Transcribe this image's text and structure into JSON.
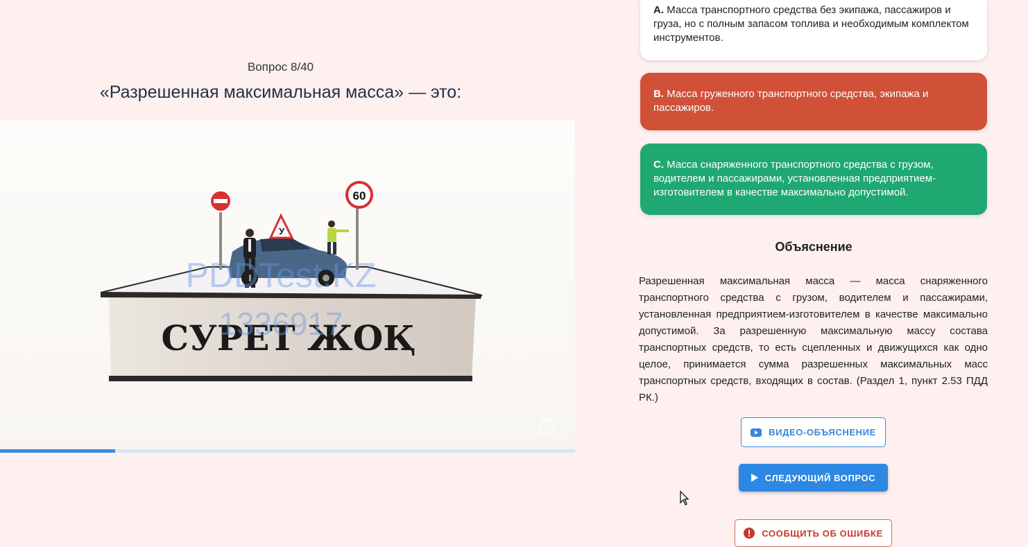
{
  "question": {
    "counter": "Вопрос 8/40",
    "title": "«Разрешенная максимальная масса» — это:",
    "progress_fraction": 0.2
  },
  "image": {
    "placeholder_text": "СУРЕТ ЖОҚ",
    "sign_speed": "60",
    "sign_letter": "У",
    "watermark_line1": "PDDTest.KZ",
    "watermark_line2": "1336917"
  },
  "answers": [
    {
      "letter": "A.",
      "text": "Масса транспортного средства без экипажа, пассажиров и груза, но с полным запасом топлива и необходимым комплектом инструментов.",
      "state": "neutral"
    },
    {
      "letter": "B.",
      "text": "Масса груженного транспортного средства, экипажа и пассажиров.",
      "state": "wrong"
    },
    {
      "letter": "C.",
      "text": "Масса снаряженного транспортного средства с грузом, водителем и пассажирами, установленная предприятием-изготовителем в качестве максимально допустимой.",
      "state": "correct"
    }
  ],
  "explanation": {
    "title": "Объяснение",
    "text": "Разрешенная максимальная масса — масса снаряженного транспортного средства с грузом, водителем и пассажирами, установленная предприятием-изготовителем в качестве максимально допустимой. За разрешенную максимальную массу состава транспортных средств, то есть сцепленных и движущихся как одно целое, принимается сумма разрешенных максимальных масс транспортных средств, входящих в состав. (Раздел 1, пункт 2.53 ПДД РК.)"
  },
  "buttons": {
    "video": "ВИДЕО-ОБЪЯСНЕНИЕ",
    "next": "СЛЕДУЮЩИЙ ВОПРОС",
    "report": "СООБЩИТЬ ОБ ОШИБКЕ"
  },
  "colors": {
    "background": "#fdf0ef",
    "wrong": "#d05038",
    "correct": "#1fa871",
    "accent": "#2d88e3"
  },
  "icons": {
    "video": "youtube-icon",
    "next": "play-icon",
    "report": "alert-circle-icon",
    "image_corner": "reload-icon"
  }
}
